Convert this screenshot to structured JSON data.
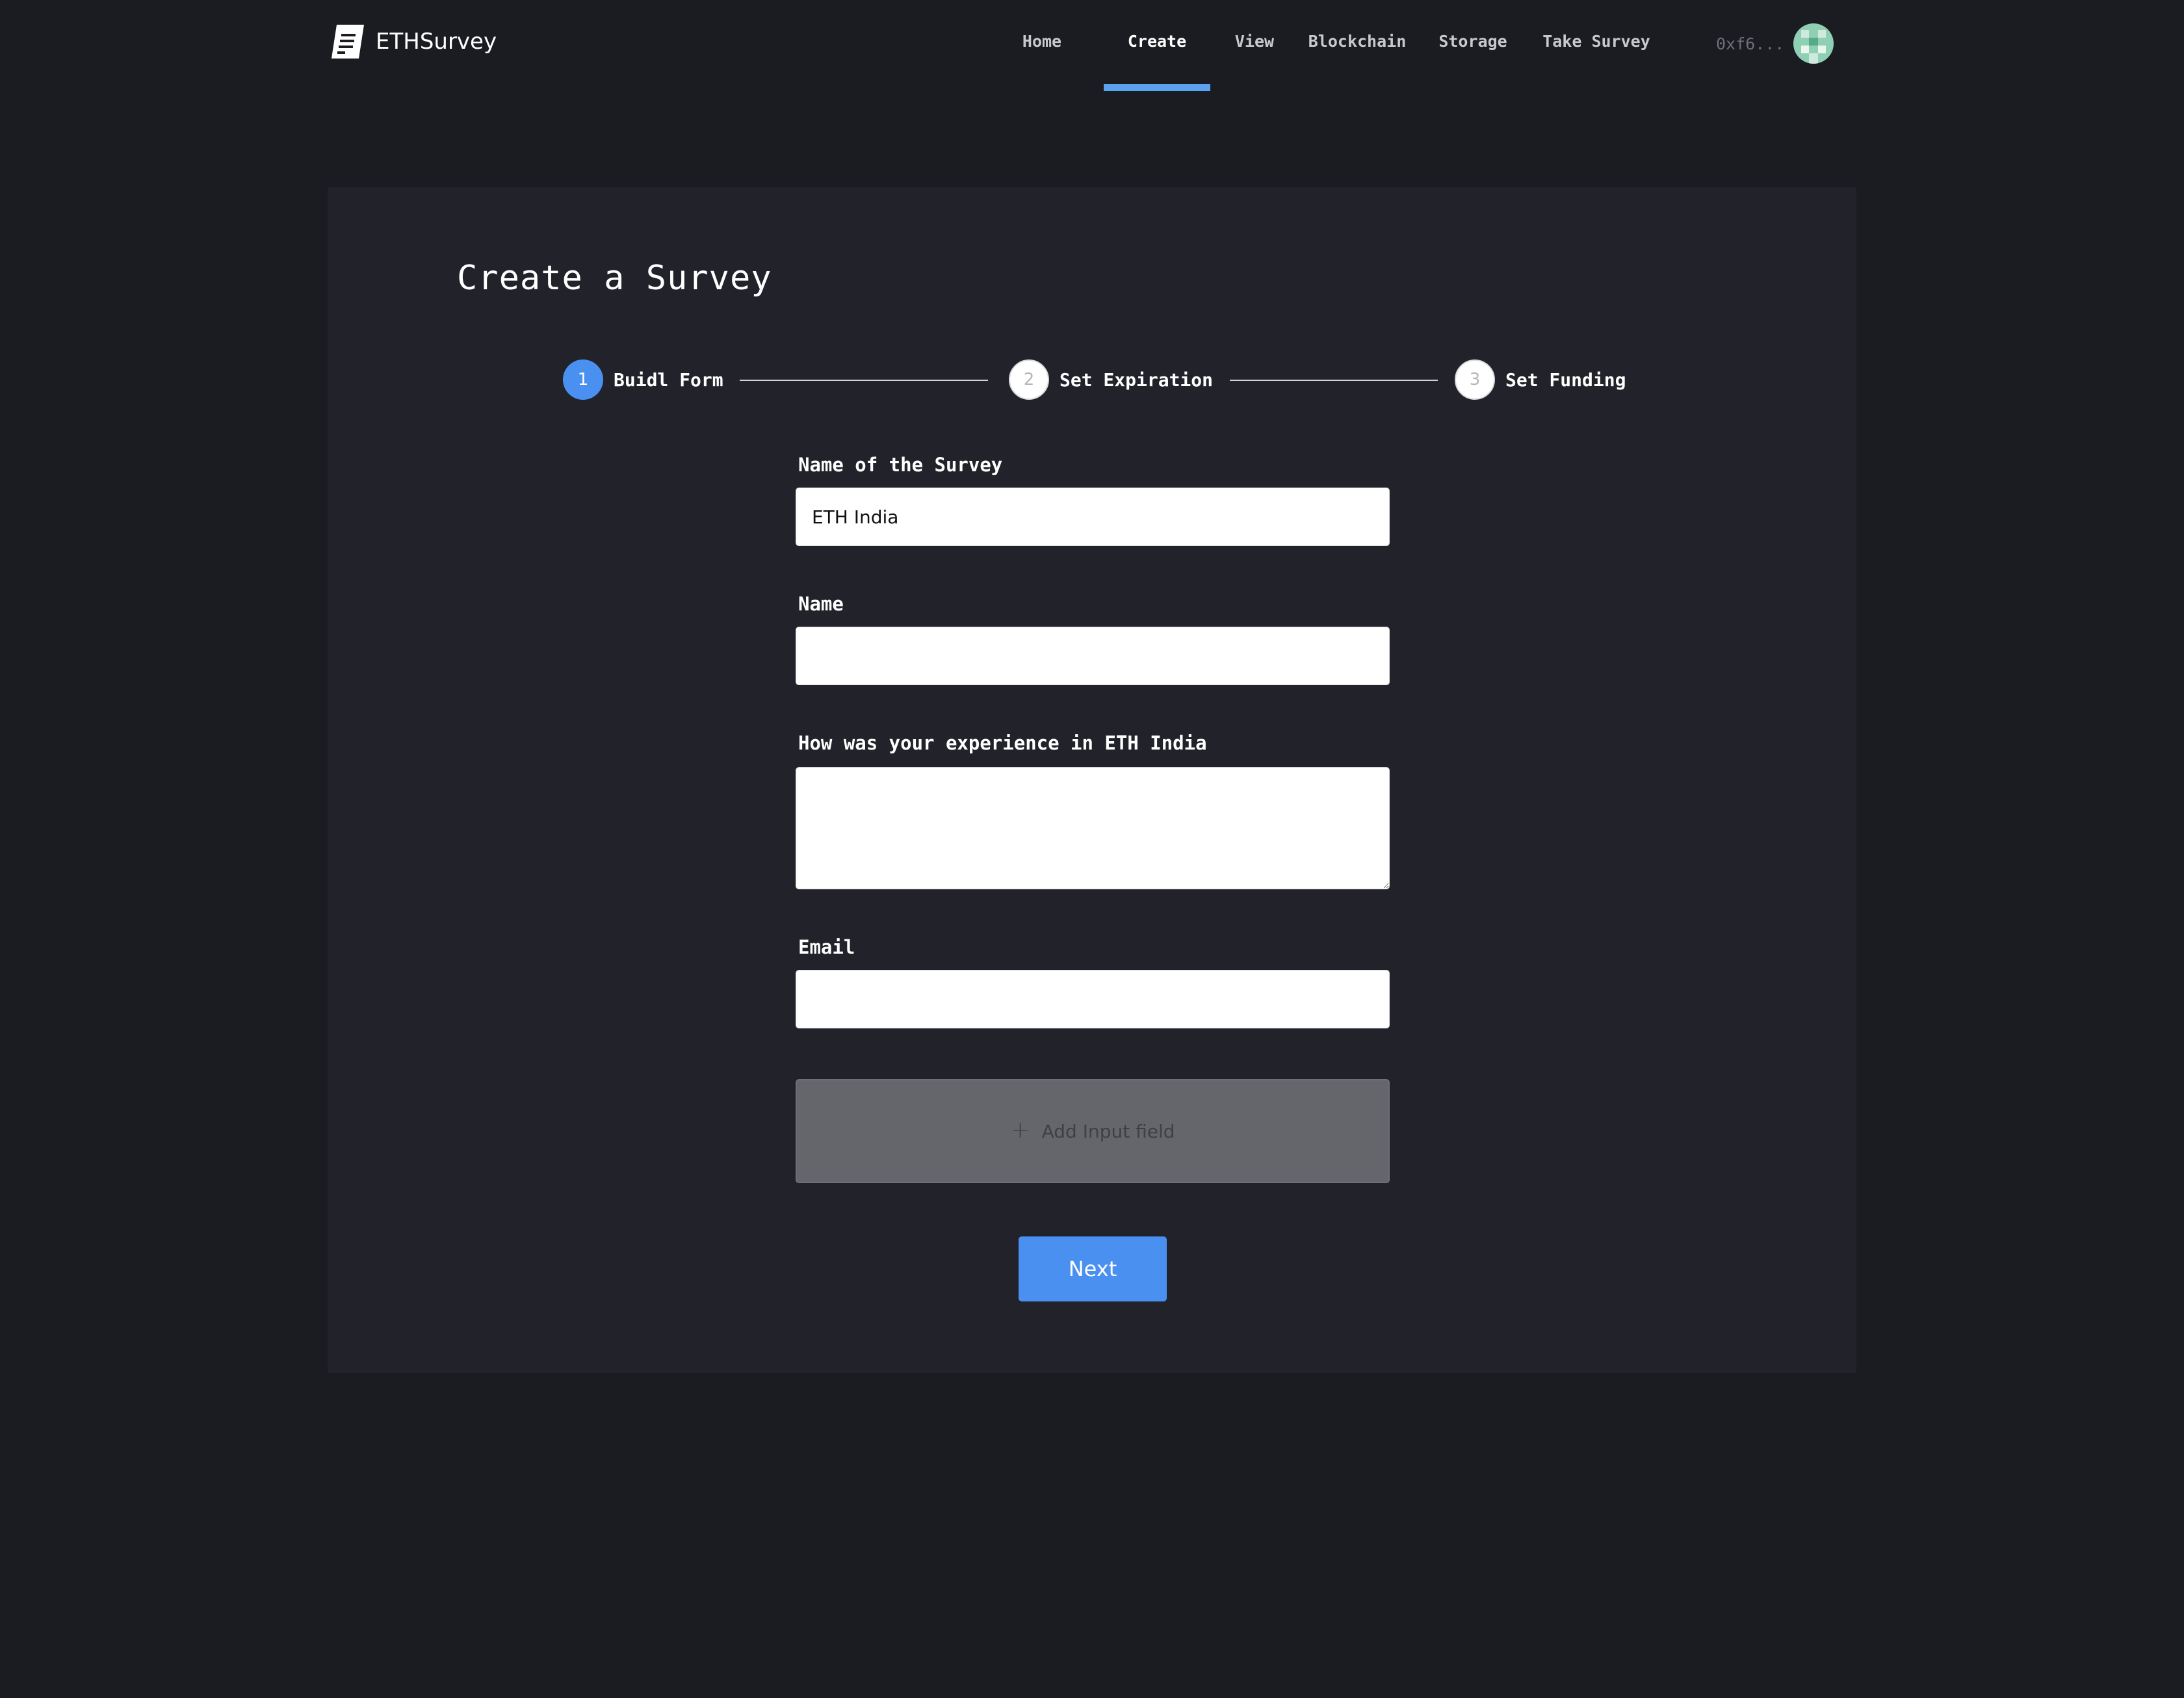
{
  "header": {
    "brand": "ETHSurvey",
    "nav": [
      {
        "label": "Home"
      },
      {
        "label": "Create"
      },
      {
        "label": "View"
      },
      {
        "label": "Blockchain"
      },
      {
        "label": "Storage"
      },
      {
        "label": "Take Survey"
      }
    ],
    "active_nav": "Create",
    "wallet_address": "0xf6..."
  },
  "page": {
    "title": "Create a Survey"
  },
  "steps": [
    {
      "number": "1",
      "label": "Buidl Form",
      "state": "active"
    },
    {
      "number": "2",
      "label": "Set Expiration",
      "state": "inactive"
    },
    {
      "number": "3",
      "label": "Set Funding",
      "state": "inactive"
    }
  ],
  "form": {
    "survey_name_label": "Name of the Survey",
    "survey_name_value": "ETH India",
    "name_label": "Name",
    "name_value": "",
    "experience_label": "How was your experience in ETH India",
    "experience_value": "",
    "email_label": "Email",
    "email_value": "",
    "add_field_label": "Add Input field",
    "next_label": "Next"
  },
  "colors": {
    "page_bg": "#1b1c21",
    "card_bg": "#22232a",
    "accent": "#4a90f0",
    "nav_underline": "#5aa2f0",
    "add_button_bg": "#65666b"
  }
}
